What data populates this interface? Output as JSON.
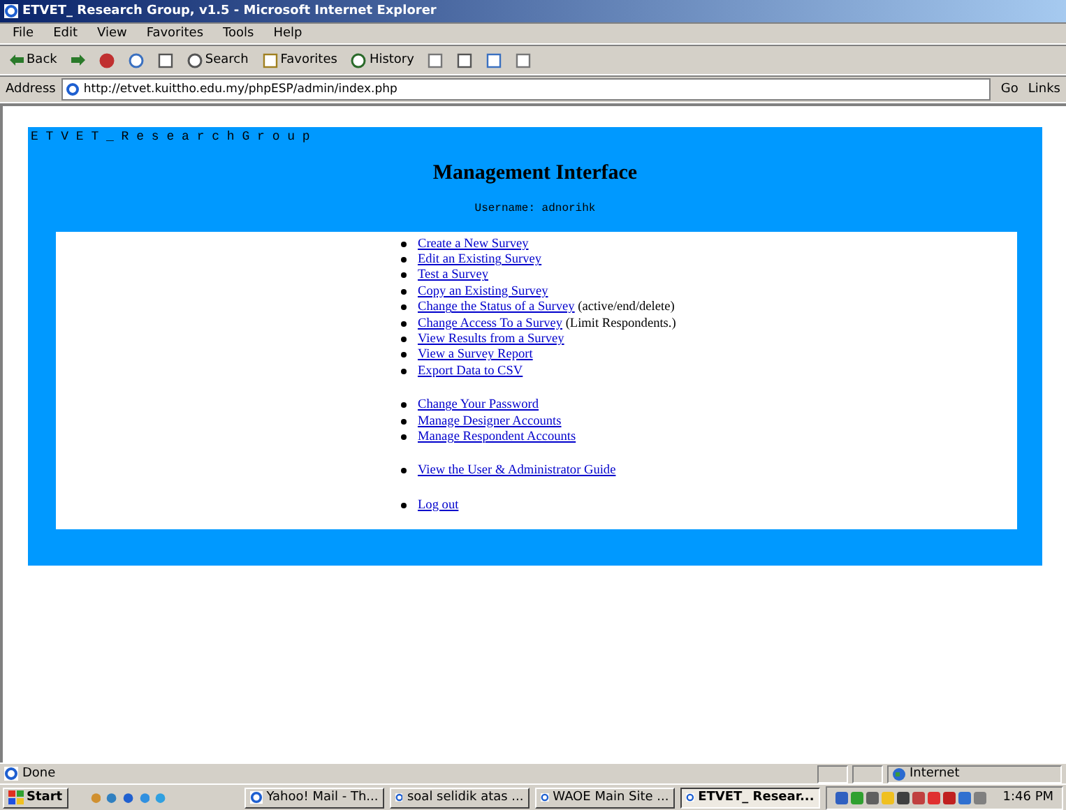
{
  "window": {
    "title": "ETVET_ Research Group, v1.5 - Microsoft Internet Explorer"
  },
  "menu": [
    "File",
    "Edit",
    "View",
    "Favorites",
    "Tools",
    "Help"
  ],
  "toolbar": [
    {
      "kind": "back",
      "label": "Back"
    },
    {
      "kind": "forward"
    },
    {
      "kind": "stop"
    },
    {
      "kind": "refresh"
    },
    {
      "kind": "home"
    },
    {
      "kind": "search",
      "label": "Search"
    },
    {
      "kind": "favorites",
      "label": "Favorites"
    },
    {
      "kind": "history",
      "label": "History"
    },
    {
      "kind": "mail"
    },
    {
      "kind": "print"
    },
    {
      "kind": "edit"
    },
    {
      "kind": "discuss"
    }
  ],
  "address": {
    "label": "Address",
    "value": "http://etvet.kuittho.edu.my/phpESP/admin/index.php",
    "go": "Go",
    "links": "Links"
  },
  "page": {
    "site": "E T V E T _ R e s e a r c h G r o u p",
    "heading": "Management Interface",
    "username": "Username: adnorihk",
    "link_groups": [
      [
        {
          "link": "Create a New Survey"
        },
        {
          "link": "Edit an Existing Survey"
        },
        {
          "link": "Test a Survey"
        },
        {
          "link": "Copy an Existing Survey"
        },
        {
          "link": "Change the Status of a Survey",
          "note": "(active/end/delete)"
        },
        {
          "link": "Change Access To a Survey",
          "note": "(Limit Respondents.)"
        },
        {
          "link": "View Results from a Survey"
        },
        {
          "link": "View a Survey Report"
        },
        {
          "link": "Export Data to CSV"
        }
      ],
      [
        {
          "link": "Change Your Password"
        },
        {
          "link": "Manage Designer Accounts"
        },
        {
          "link": "Manage Respondent Accounts"
        }
      ],
      [
        {
          "link": "View the User & Administrator Guide"
        }
      ],
      [
        {
          "link": "Log out"
        }
      ]
    ]
  },
  "status_bar": {
    "text": "Done",
    "zone": "Internet"
  },
  "taskbar": {
    "start": "Start",
    "tasks": [
      {
        "label": "Yahoo! Mail - Th...",
        "selected": false
      },
      {
        "label": "soal selidik atas ...",
        "selected": false
      },
      {
        "label": "WAOE Main Site ...",
        "selected": false
      },
      {
        "label": "ETVET_ Resear...",
        "selected": true
      }
    ],
    "clock": "1:46 PM"
  }
}
